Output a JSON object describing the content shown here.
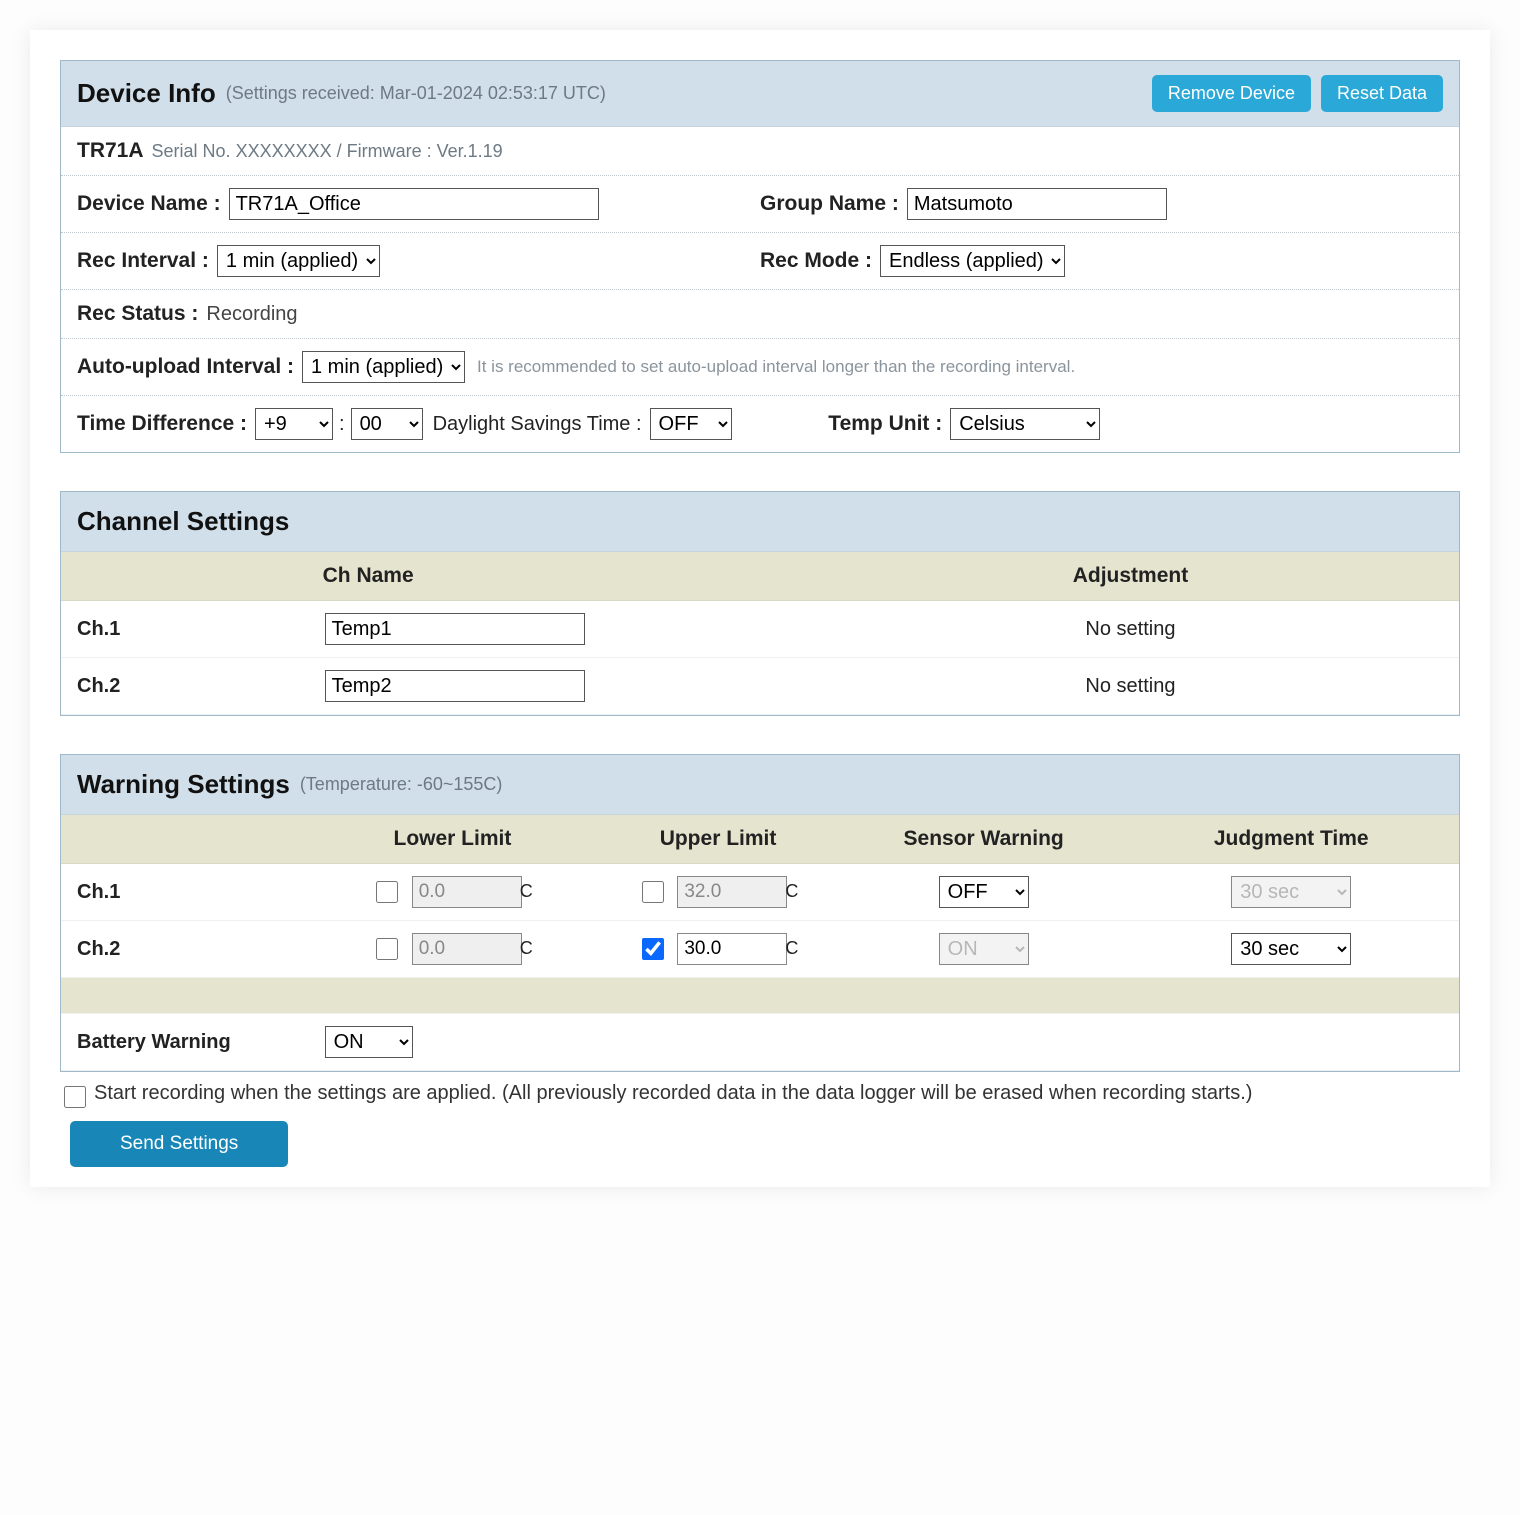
{
  "deviceInfo": {
    "title": "Device Info",
    "subtitle": "(Settings received: Mar-01-2024 02:53:17 UTC)",
    "removeBtn": "Remove Device",
    "resetBtn": "Reset Data",
    "model": "TR71A",
    "serialLine": "Serial No. XXXXXXXX / Firmware : Ver.1.19",
    "deviceNameLabel": "Device Name :",
    "deviceName": "TR71A_Office",
    "groupNameLabel": "Group Name :",
    "groupName": "Matsumoto",
    "recIntervalLabel": "Rec Interval :",
    "recInterval": "1 min (applied)",
    "recModeLabel": "Rec Mode :",
    "recMode": "Endless (applied)",
    "recStatusLabel": "Rec Status :",
    "recStatus": "Recording",
    "autoUploadLabel": "Auto-upload Interval :",
    "autoUpload": "1 min (applied)",
    "autoUploadHint": "It is recommended to set auto-upload interval longer than the recording interval.",
    "timeDiffLabel": "Time Difference :",
    "timeDiffHour": "+9",
    "timeDiffMin": "00",
    "dstLabel": "Daylight Savings Time :",
    "dst": "OFF",
    "tempUnitLabel": "Temp Unit :",
    "tempUnit": "Celsius",
    "colon": ":"
  },
  "channelSettings": {
    "title": "Channel Settings",
    "cols": {
      "name": "Ch Name",
      "adj": "Adjustment"
    },
    "rows": [
      {
        "label": "Ch.1",
        "name": "Temp1",
        "adj": "No setting"
      },
      {
        "label": "Ch.2",
        "name": "Temp2",
        "adj": "No setting"
      }
    ]
  },
  "warningSettings": {
    "title": "Warning Settings",
    "subtitle": "(Temperature: -60~155C)",
    "cols": {
      "lower": "Lower Limit",
      "upper": "Upper Limit",
      "sensor": "Sensor Warning",
      "judgment": "Judgment Time"
    },
    "unit": "C",
    "rows": [
      {
        "label": "Ch.1",
        "lowerChecked": false,
        "lower": "0.0",
        "upperChecked": false,
        "upper": "32.0",
        "sensor": "OFF",
        "sensorDisabled": false,
        "judgment": "30 sec",
        "judgmentDisabled": true
      },
      {
        "label": "Ch.2",
        "lowerChecked": false,
        "lower": "0.0",
        "upperChecked": true,
        "upper": "30.0",
        "sensor": "ON",
        "sensorDisabled": true,
        "judgment": "30 sec",
        "judgmentDisabled": false
      }
    ],
    "batteryLabel": "Battery Warning",
    "battery": "ON"
  },
  "footer": {
    "startRecording": "Start recording when the settings are applied. (All previously recorded data in the data logger will be erased when recording starts.)",
    "sendBtn": "Send Settings"
  }
}
